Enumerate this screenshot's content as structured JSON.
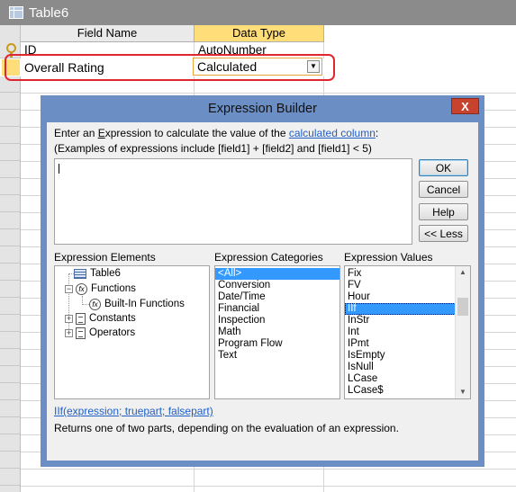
{
  "window": {
    "title": "Table6"
  },
  "table_design": {
    "headers": {
      "field_name": "Field Name",
      "data_type": "Data Type"
    },
    "rows": [
      {
        "field": "ID",
        "type": "AutoNumber"
      },
      {
        "field": "Overall Rating",
        "type": "Calculated"
      }
    ],
    "highlight_color": "#e0262e"
  },
  "dialog": {
    "title": "Expression Builder",
    "close_label": "X",
    "intro_line1_pre": "Enter an ",
    "intro_line1_ex": "E",
    "intro_line1_mid": "xpression to calculate the value of the ",
    "intro_link": "calculated column",
    "intro_line1_post": ":",
    "intro_line2": "(Examples of expressions include [field1] + [field2] and [field1] < 5)",
    "expression_value": "",
    "buttons": {
      "ok": "OK",
      "cancel": "Cancel",
      "help": "Help",
      "less": "<< Less"
    },
    "elements": {
      "label": "Expression Elements",
      "items": {
        "table": "Table6",
        "functions": "Functions",
        "builtin": "Built-In Functions",
        "constants": "Constants",
        "operators": "Operators"
      }
    },
    "categories": {
      "label": "Expression Categories",
      "items": [
        "<All>",
        "Conversion",
        "Date/Time",
        "Financial",
        "Inspection",
        "Math",
        "Program Flow",
        "Text"
      ],
      "selected": "<All>"
    },
    "values": {
      "label": "Expression Values",
      "items": [
        "Fix",
        "FV",
        "Hour",
        "IIf",
        "InStr",
        "Int",
        "IPmt",
        "IsEmpty",
        "IsNull",
        "LCase",
        "LCase$"
      ],
      "selected": "IIf"
    },
    "syntax_link": "IIf(expression; truepart; falsepart)",
    "description": "Returns one of two parts, depending on the evaluation of an expression.",
    "colors": {
      "frame": "#6b8fc4",
      "close": "#c7432e",
      "selection": "#3399ff",
      "link": "#1f5fc4"
    }
  }
}
